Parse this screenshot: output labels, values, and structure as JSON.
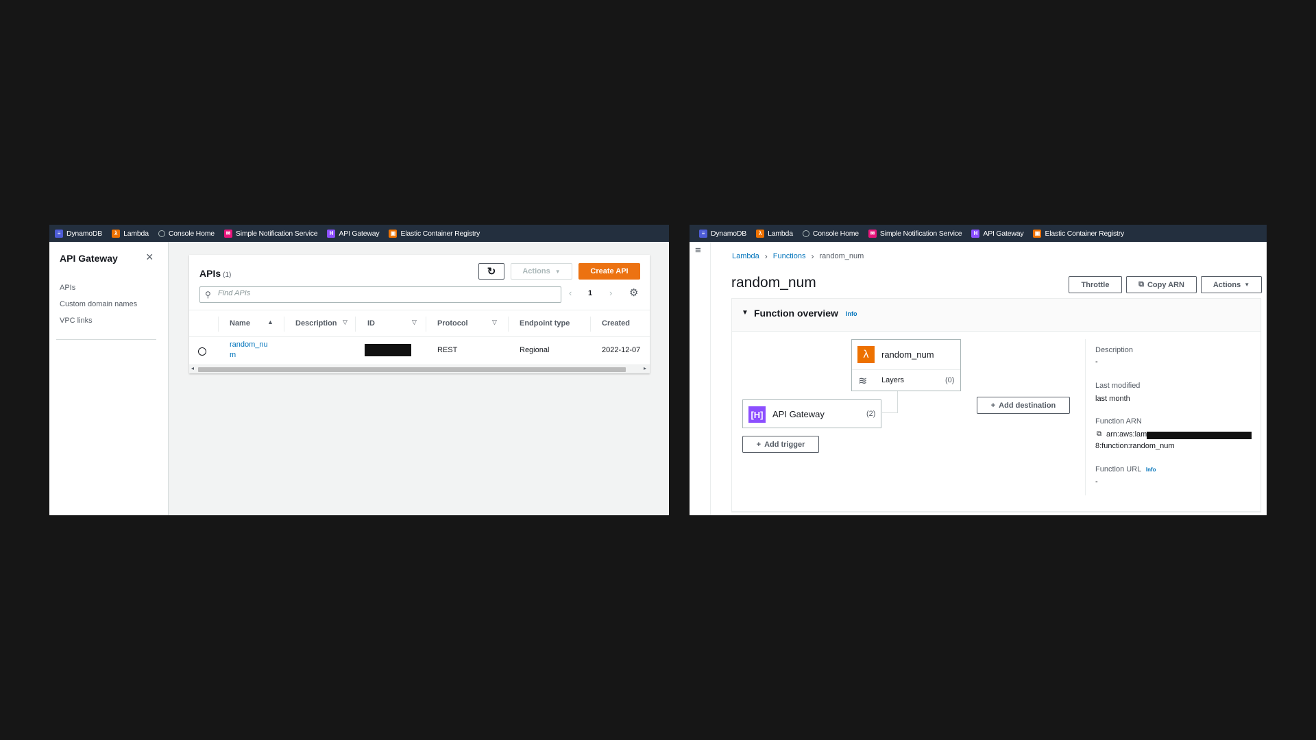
{
  "favorites": [
    {
      "icon": "dynamodb-icon",
      "label": "DynamoDB"
    },
    {
      "icon": "lambda-icon",
      "label": "Lambda"
    },
    {
      "icon": "console-home-icon",
      "label": "Console Home"
    },
    {
      "icon": "sns-icon",
      "label": "Simple Notification Service"
    },
    {
      "icon": "api-gateway-icon",
      "label": "API Gateway"
    },
    {
      "icon": "ecr-icon",
      "label": "Elastic Container Registry"
    }
  ],
  "colors": {
    "topbar": "#232f3e",
    "accent_orange": "#ec7211",
    "link": "#0073bb",
    "lambda": "#ed7100",
    "apigateway": "#8c4fff"
  },
  "apigw": {
    "sidenav": {
      "title": "API Gateway",
      "close": "×",
      "items": [
        "APIs",
        "Custom domain names",
        "VPC links"
      ]
    },
    "card": {
      "title": "APIs",
      "count": "(1)",
      "refresh": "↻",
      "actions": "Actions",
      "create": "Create API",
      "search_placeholder": "Find APIs",
      "prev": "‹",
      "page": "1",
      "next": "›",
      "settings": "⚙"
    },
    "table": {
      "columns": [
        "Name",
        "Description",
        "ID",
        "Protocol",
        "Endpoint type",
        "Created"
      ],
      "rows": [
        {
          "name_line1": "random_nu",
          "name_line2": "m",
          "description": "",
          "protocol": "REST",
          "endpoint_type": "Regional",
          "created": "2022-12-07"
        }
      ]
    }
  },
  "lambda": {
    "menu": "≡",
    "breadcrumbs": [
      "Lambda",
      "Functions",
      "random_num"
    ],
    "title": "random_num",
    "buttons": {
      "throttle": "Throttle",
      "copy_arn": "Copy ARN",
      "actions": "Actions"
    },
    "overview": {
      "title": "Function overview",
      "info": "Info",
      "function_name": "random_num",
      "layers_label": "Layers",
      "layers_count": "(0)",
      "trigger_name": "API Gateway",
      "trigger_count": "(2)",
      "add_trigger": "Add trigger",
      "add_destination": "Add destination"
    },
    "details": {
      "description_label": "Description",
      "description_value": "-",
      "last_modified_label": "Last modified",
      "last_modified_value": "last month",
      "arn_label": "Function ARN",
      "arn_prefix": "arn:aws:lam",
      "arn_suffix": "8:function:random_num",
      "url_label": "Function URL",
      "url_info": "Info",
      "url_value": "-"
    }
  }
}
